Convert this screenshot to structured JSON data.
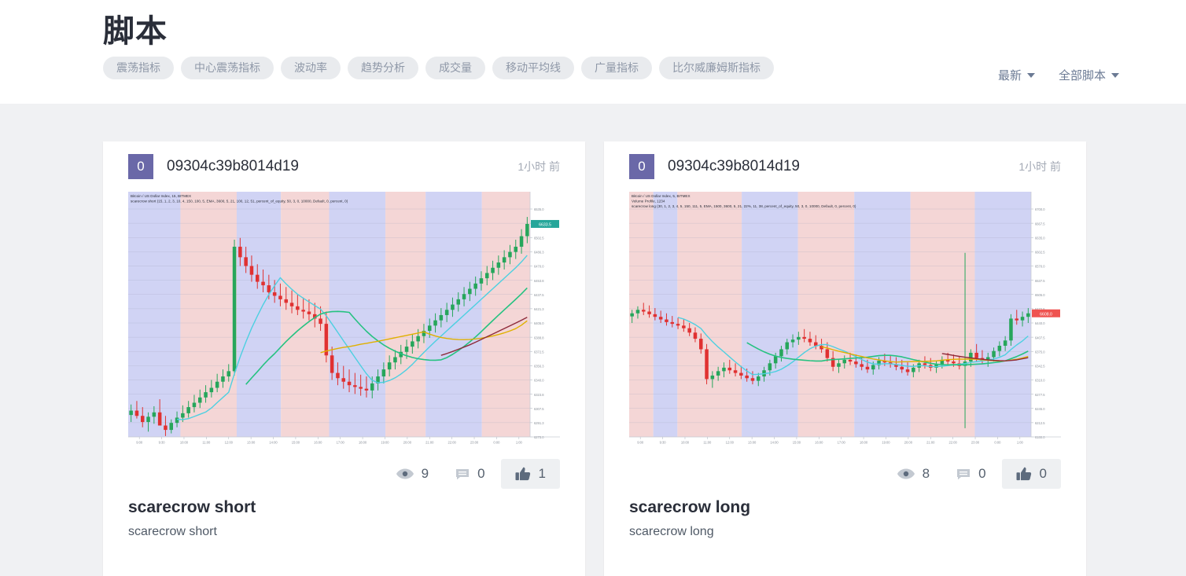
{
  "header": {
    "title": "脚本",
    "filters": [
      {
        "label": "震荡指标"
      },
      {
        "label": "中心震荡指标"
      },
      {
        "label": "波动率"
      },
      {
        "label": "趋势分析"
      },
      {
        "label": "成交量"
      },
      {
        "label": "移动平均线"
      },
      {
        "label": "广量指标"
      },
      {
        "label": "比尔威廉姆斯指标"
      }
    ],
    "sort": {
      "label": "最新"
    },
    "scope": {
      "label": "全部脚本"
    }
  },
  "cards": [
    {
      "avatar_initial": "0",
      "author": "09304c39b8014d19",
      "timeago": "1小时 前",
      "title": "scarecrow short",
      "description": "scarecrow short",
      "stats": {
        "views_label": "9",
        "comments_label": "0",
        "boosts_label": "1",
        "boosted": true
      },
      "chart": {
        "symbol_line": "Bitcoin / US Dollar Index, 15, BITMEX",
        "study_line": "scarecrow short (15, 1, 2, 3, 10, 4, 150, 100, 5, EMA, 3600, 5, 21, 100, 12, 51, percent_of_equity, 50, 3, 0, 10000, Default, 0, percent, 0)",
        "last_price_badge": "6633.5",
        "badge_color": "#26a69a"
      }
    },
    {
      "avatar_initial": "0",
      "author": "09304c39b8014d19",
      "timeago": "1小时 前",
      "title": "scarecrow long",
      "description": "scarecrow long",
      "stats": {
        "views_label": "8",
        "comments_label": "0",
        "boosts_label": "0",
        "boosted": true
      },
      "chart": {
        "symbol_line": "Bitcoin / US Dollar Index, 5, BITMEX",
        "substudy_line": "Volume Profile, 1234",
        "study_line": "scarecrow long (30, 1, 2, 3, 4, 5, 150, 111, 5, EMA, 1500, 3600, 5, 21, 22%, 11, 38, percent_of_equity, 50, 3, 0, 10000, Default, 0, percent, 0)",
        "last_price_badge": "6608.0",
        "badge_color": "#ef5350"
      }
    }
  ],
  "icons": {
    "views": "eye-icon",
    "comments": "comment-icon",
    "boosts": "thumbs-up-icon",
    "dropdown": "chevron-down-icon"
  },
  "chart_data": [
    {
      "type": "candlestick",
      "title": "Bitcoin / US Dollar Index, 15, BITMEX",
      "series_name": "scarecrow short",
      "ylim": [
        6275,
        6535
      ],
      "grid": true,
      "legend_position": "top-left",
      "background_bands": [
        {
          "from": 0.0,
          "to": 0.13,
          "color": "#c8cbf2"
        },
        {
          "from": 0.13,
          "to": 0.27,
          "color": "#f2cfcf"
        },
        {
          "from": 0.27,
          "to": 0.38,
          "color": "#c8cbf2"
        },
        {
          "from": 0.38,
          "to": 0.5,
          "color": "#f2cfcf"
        },
        {
          "from": 0.5,
          "to": 0.64,
          "color": "#c8cbf2"
        },
        {
          "from": 0.64,
          "to": 0.74,
          "color": "#f2cfcf"
        },
        {
          "from": 0.74,
          "to": 0.88,
          "color": "#c8cbf2"
        },
        {
          "from": 0.88,
          "to": 1.0,
          "color": "#f2cfcf"
        }
      ],
      "ohlc": [
        [
          6300,
          6312,
          6292,
          6305
        ],
        [
          6305,
          6316,
          6296,
          6299
        ],
        [
          6299,
          6309,
          6286,
          6292
        ],
        [
          6292,
          6303,
          6281,
          6298
        ],
        [
          6298,
          6310,
          6290,
          6303
        ],
        [
          6303,
          6318,
          6295,
          6288
        ],
        [
          6288,
          6299,
          6276,
          6283
        ],
        [
          6283,
          6295,
          6279,
          6291
        ],
        [
          6291,
          6304,
          6286,
          6297
        ],
        [
          6297,
          6311,
          6292,
          6302
        ],
        [
          6302,
          6316,
          6297,
          6309
        ],
        [
          6309,
          6323,
          6303,
          6314
        ],
        [
          6314,
          6329,
          6308,
          6320
        ],
        [
          6320,
          6334,
          6314,
          6326
        ],
        [
          6326,
          6340,
          6320,
          6331
        ],
        [
          6331,
          6347,
          6326,
          6338
        ],
        [
          6338,
          6352,
          6331,
          6344
        ],
        [
          6344,
          6358,
          6338,
          6350
        ],
        [
          6350,
          6500,
          6345,
          6492
        ],
        [
          6492,
          6502,
          6470,
          6480
        ],
        [
          6480,
          6492,
          6462,
          6470
        ],
        [
          6470,
          6482,
          6452,
          6460
        ],
        [
          6460,
          6472,
          6444,
          6452
        ],
        [
          6452,
          6466,
          6440,
          6448
        ],
        [
          6448,
          6460,
          6432,
          6440
        ],
        [
          6440,
          6454,
          6428,
          6436
        ],
        [
          6436,
          6450,
          6424,
          6432
        ],
        [
          6432,
          6446,
          6420,
          6428
        ],
        [
          6428,
          6442,
          6416,
          6424
        ],
        [
          6424,
          6438,
          6414,
          6420
        ],
        [
          6420,
          6434,
          6410,
          6418
        ],
        [
          6418,
          6432,
          6408,
          6415
        ],
        [
          6415,
          6428,
          6400,
          6410
        ],
        [
          6410,
          6424,
          6396,
          6404
        ],
        [
          6404,
          6418,
          6360,
          6368
        ],
        [
          6368,
          6378,
          6340,
          6348
        ],
        [
          6348,
          6360,
          6334,
          6342
        ],
        [
          6342,
          6356,
          6330,
          6338
        ],
        [
          6338,
          6352,
          6326,
          6334
        ],
        [
          6334,
          6348,
          6324,
          6332
        ],
        [
          6332,
          6346,
          6322,
          6330
        ],
        [
          6330,
          6344,
          6320,
          6328
        ],
        [
          6328,
          6344,
          6319,
          6336
        ],
        [
          6336,
          6352,
          6328,
          6344
        ],
        [
          6344,
          6360,
          6336,
          6352
        ],
        [
          6352,
          6368,
          6344,
          6360
        ],
        [
          6360,
          6374,
          6352,
          6366
        ],
        [
          6366,
          6380,
          6358,
          6372
        ],
        [
          6372,
          6386,
          6364,
          6378
        ],
        [
          6378,
          6392,
          6370,
          6384
        ],
        [
          6384,
          6398,
          6376,
          6390
        ],
        [
          6390,
          6404,
          6382,
          6396
        ],
        [
          6396,
          6410,
          6388,
          6402
        ],
        [
          6402,
          6416,
          6394,
          6408
        ],
        [
          6408,
          6422,
          6400,
          6414
        ],
        [
          6414,
          6428,
          6406,
          6420
        ],
        [
          6420,
          6434,
          6412,
          6426
        ],
        [
          6426,
          6440,
          6418,
          6432
        ],
        [
          6432,
          6446,
          6424,
          6438
        ],
        [
          6438,
          6452,
          6430,
          6444
        ],
        [
          6444,
          6458,
          6436,
          6450
        ],
        [
          6450,
          6464,
          6442,
          6456
        ],
        [
          6456,
          6470,
          6448,
          6462
        ],
        [
          6462,
          6476,
          6454,
          6468
        ],
        [
          6468,
          6482,
          6460,
          6474
        ],
        [
          6474,
          6488,
          6466,
          6480
        ],
        [
          6480,
          6494,
          6472,
          6486
        ],
        [
          6486,
          6500,
          6478,
          6492
        ],
        [
          6492,
          6512,
          6484,
          6504
        ],
        [
          6504,
          6526,
          6496,
          6518
        ]
      ]
    },
    {
      "type": "candlestick",
      "title": "Bitcoin / US Dollar Index, 5, BITMEX",
      "series_name": "scarecrow long",
      "ylim": [
        6180,
        6700
      ],
      "grid": true,
      "legend_position": "top-left",
      "background_bands": [
        {
          "from": 0.0,
          "to": 0.06,
          "color": "#f2cfcf"
        },
        {
          "from": 0.06,
          "to": 0.12,
          "color": "#c8cbf2"
        },
        {
          "from": 0.12,
          "to": 0.28,
          "color": "#f2cfcf"
        },
        {
          "from": 0.28,
          "to": 0.42,
          "color": "#c8cbf2"
        },
        {
          "from": 0.42,
          "to": 0.56,
          "color": "#f2cfcf"
        },
        {
          "from": 0.56,
          "to": 0.7,
          "color": "#c8cbf2"
        },
        {
          "from": 0.7,
          "to": 0.86,
          "color": "#f2cfcf"
        },
        {
          "from": 0.86,
          "to": 1.0,
          "color": "#c8cbf2"
        }
      ],
      "ohlc": [
        [
          6455,
          6470,
          6440,
          6462
        ],
        [
          6462,
          6478,
          6450,
          6470
        ],
        [
          6470,
          6486,
          6458,
          6466
        ],
        [
          6466,
          6480,
          6452,
          6460
        ],
        [
          6460,
          6474,
          6446,
          6454
        ],
        [
          6454,
          6468,
          6440,
          6448
        ],
        [
          6448,
          6462,
          6434,
          6442
        ],
        [
          6442,
          6456,
          6430,
          6438
        ],
        [
          6438,
          6452,
          6426,
          6434
        ],
        [
          6434,
          6448,
          6420,
          6428
        ],
        [
          6428,
          6440,
          6410,
          6418
        ],
        [
          6418,
          6430,
          6396,
          6404
        ],
        [
          6404,
          6416,
          6370,
          6380
        ],
        [
          6380,
          6392,
          6300,
          6312
        ],
        [
          6312,
          6330,
          6292,
          6320
        ],
        [
          6320,
          6340,
          6308,
          6330
        ],
        [
          6330,
          6350,
          6316,
          6338
        ],
        [
          6338,
          6356,
          6324,
          6332
        ],
        [
          6332,
          6348,
          6318,
          6326
        ],
        [
          6326,
          6342,
          6312,
          6320
        ],
        [
          6320,
          6336,
          6306,
          6314
        ],
        [
          6314,
          6330,
          6300,
          6308
        ],
        [
          6308,
          6326,
          6296,
          6318
        ],
        [
          6318,
          6340,
          6306,
          6332
        ],
        [
          6332,
          6356,
          6320,
          6348
        ],
        [
          6348,
          6372,
          6336,
          6364
        ],
        [
          6364,
          6388,
          6352,
          6380
        ],
        [
          6380,
          6404,
          6368,
          6396
        ],
        [
          6396,
          6414,
          6384,
          6402
        ],
        [
          6402,
          6420,
          6390,
          6408
        ],
        [
          6408,
          6426,
          6396,
          6404
        ],
        [
          6404,
          6420,
          6388,
          6396
        ],
        [
          6396,
          6412,
          6380,
          6388
        ],
        [
          6388,
          6404,
          6372,
          6380
        ],
        [
          6380,
          6396,
          6352,
          6360
        ],
        [
          6360,
          6376,
          6330,
          6340
        ],
        [
          6340,
          6358,
          6326,
          6348
        ],
        [
          6348,
          6366,
          6336,
          6356
        ],
        [
          6356,
          6372,
          6344,
          6352
        ],
        [
          6352,
          6368,
          6338,
          6346
        ],
        [
          6346,
          6362,
          6332,
          6340
        ],
        [
          6340,
          6356,
          6326,
          6334
        ],
        [
          6334,
          6352,
          6322,
          6344
        ],
        [
          6344,
          6362,
          6334,
          6354
        ],
        [
          6354,
          6370,
          6342,
          6350
        ],
        [
          6350,
          6366,
          6338,
          6346
        ],
        [
          6346,
          6362,
          6332,
          6340
        ],
        [
          6340,
          6356,
          6326,
          6334
        ],
        [
          6334,
          6350,
          6320,
          6328
        ],
        [
          6328,
          6346,
          6316,
          6338
        ],
        [
          6338,
          6356,
          6328,
          6348
        ],
        [
          6348,
          6364,
          6336,
          6344
        ],
        [
          6344,
          6360,
          6330,
          6338
        ],
        [
          6338,
          6354,
          6326,
          6346
        ],
        [
          6346,
          6364,
          6336,
          6356
        ],
        [
          6356,
          6372,
          6344,
          6352
        ],
        [
          6352,
          6368,
          6340,
          6348
        ],
        [
          6348,
          6364,
          6334,
          6342
        ],
        [
          6342,
          6600,
          6200,
          6352
        ],
        [
          6352,
          6380,
          6340,
          6372
        ],
        [
          6372,
          6392,
          6352,
          6360
        ],
        [
          6360,
          6378,
          6346,
          6354
        ],
        [
          6354,
          6372,
          6340,
          6362
        ],
        [
          6362,
          6384,
          6352,
          6376
        ],
        [
          6376,
          6398,
          6364,
          6388
        ],
        [
          6388,
          6410,
          6376,
          6400
        ],
        [
          6400,
          6460,
          6388,
          6450
        ],
        [
          6450,
          6470,
          6436,
          6446
        ],
        [
          6446,
          6466,
          6432,
          6454
        ],
        [
          6454,
          6474,
          6440,
          6462
        ]
      ]
    }
  ]
}
